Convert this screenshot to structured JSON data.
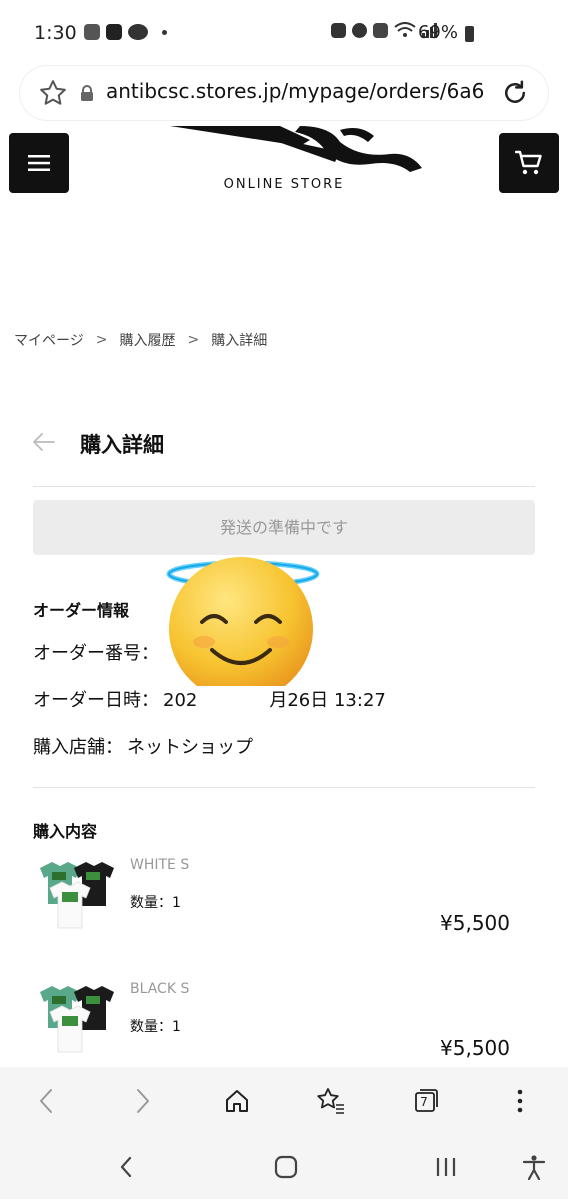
{
  "status_bar": {
    "time": "1:30",
    "battery": "69%",
    "left_icons": [
      "mail-icon",
      "paypay-icon",
      "line-icon"
    ],
    "right_icons": [
      "battery-saver-icon",
      "alarm-icon",
      "mute-icon",
      "wifi-icon",
      "signal-icon"
    ]
  },
  "browser": {
    "url": "antibcsc.stores.jp/mypage/orders/6a6",
    "tab_count": "7"
  },
  "header": {
    "logo_text": "ONLINE STORE"
  },
  "breadcrumb": {
    "items": [
      "マイページ",
      "購入履歴",
      "購入詳細"
    ],
    "separator": ">"
  },
  "page": {
    "title": "購入詳細",
    "status": "発送の準備中です"
  },
  "order_info": {
    "heading": "オーダー情報",
    "number_label": "オーダー番号：",
    "date_label": "オーダー日時：",
    "date_value_start": "202",
    "date_value_end": "月26日 13:27",
    "store_label": "購入店舗：",
    "store_value": "ネットショップ"
  },
  "purchase": {
    "heading": "購入内容",
    "items": [
      {
        "variant": "WHITE S",
        "qty": "数量：1",
        "price": "¥5,500"
      },
      {
        "variant": "BLACK S",
        "qty": "数量：1",
        "price": "¥5,500"
      }
    ]
  },
  "colors": {
    "header_button_bg": "#111111",
    "status_pill_bg": "#ececec",
    "status_pill_text": "#999999",
    "toolbar_bg": "#f5f5f5"
  }
}
